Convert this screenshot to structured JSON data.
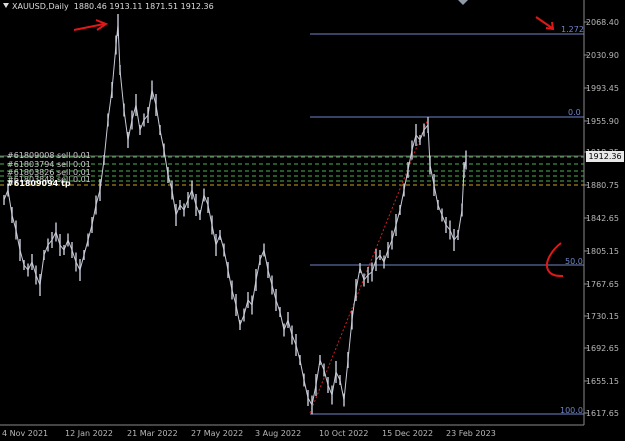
{
  "header": {
    "symbol_label": "XAUUSD,Daily",
    "ohlc_text": "1880.46 1913.11 1871.51 1912.36"
  },
  "current_price": "1912.36",
  "price_axis": [
    "2068.40",
    "2030.90",
    "1993.45",
    "1955.90",
    "1918.35",
    "1880.75",
    "1842.65",
    "1805.15",
    "1767.65",
    "1730.15",
    "1692.65",
    "1655.15",
    "1617.65"
  ],
  "time_axis": [
    "4 Nov 2021",
    "12 Jan 2022",
    "21 Mar 2022",
    "27 May 2022",
    "3 Aug 2022",
    "10 Oct 2022",
    "15 Dec 2022",
    "23 Feb 2023"
  ],
  "fibonacci": {
    "levels": [
      "1.272",
      "0.0",
      "50.0",
      "100.0"
    ],
    "color": "#6f86c8"
  },
  "orders": [
    "#61809008 sell 0.01",
    "#61803794 sell 0.01",
    "#61803826 sell 0.01",
    "#61803848 sell 0.01",
    "#61809094 tp"
  ],
  "colors": {
    "background": "#000000",
    "candles": "#c8ccd8",
    "annotation_arrows": "#e01818",
    "order_lines": "#4caf50",
    "trend_line": "#d02020"
  }
}
